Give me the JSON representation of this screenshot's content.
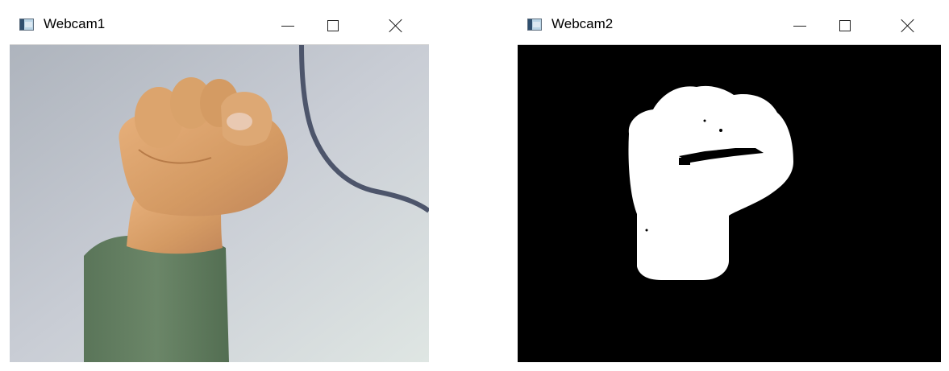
{
  "windows": [
    {
      "title": "Webcam1",
      "controls": {
        "minimize": "minimize",
        "maximize": "maximize",
        "close": "close"
      }
    },
    {
      "title": "Webcam2",
      "controls": {
        "minimize": "minimize",
        "maximize": "maximize",
        "close": "close"
      }
    }
  ],
  "icons": {
    "app": "window-app-icon",
    "minimize": "minimize-icon",
    "maximize": "maximize-icon",
    "close": "close-icon"
  },
  "colors": {
    "camera_background": "#c7cbd3",
    "skin": "#d9a26a",
    "sleeve": "#5f7a5e",
    "mask_background": "#000000",
    "mask_foreground": "#ffffff"
  }
}
